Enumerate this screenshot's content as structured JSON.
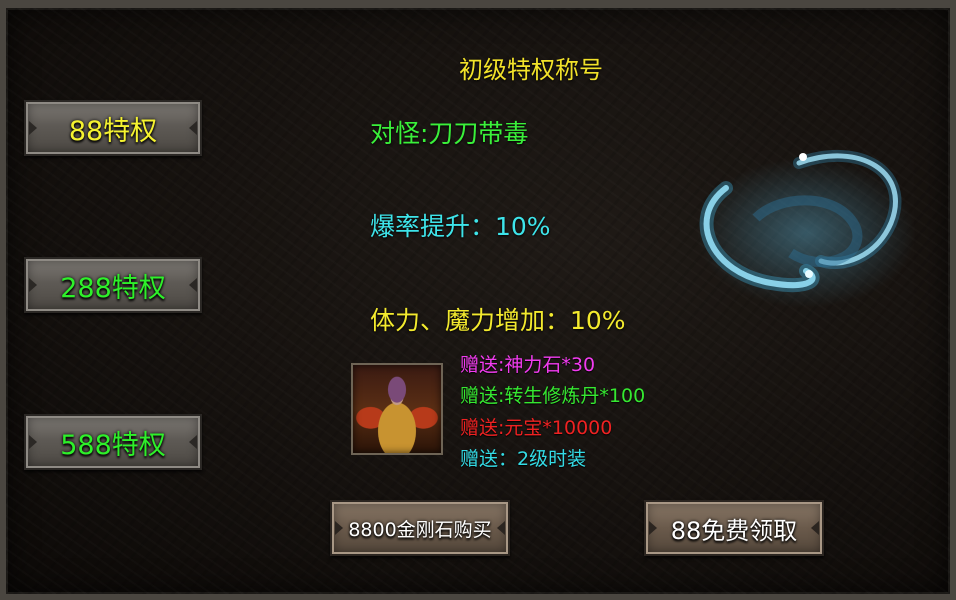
{
  "panel": {
    "title": "初级特权称号"
  },
  "tiers": [
    {
      "label": "88特权",
      "color": "#f4f230"
    },
    {
      "label": "288特权",
      "color": "#2ef02a"
    },
    {
      "label": "588特权",
      "color": "#2ef02a"
    }
  ],
  "stats": {
    "vs_monster": "对怪:刀刀带毒",
    "drop_rate": "爆率提升：10%",
    "hp_mp": "体力、魔力增加：10%"
  },
  "gifts": [
    {
      "text": "赠送:神力石*30",
      "color": "#f23cf0"
    },
    {
      "text": "赠送:转生修炼丹*100",
      "color": "#36e831"
    },
    {
      "text": "赠送:元宝*10000",
      "color": "#ee2222"
    },
    {
      "text": "赠送：2级时装",
      "color": "#34dce6"
    }
  ],
  "actions": {
    "buy_label": "8800金刚石购买",
    "claim_label": "88免费领取"
  },
  "icons": {
    "title_effect": "cyan-swirl-effect",
    "reward_item": "character-costume-icon"
  }
}
